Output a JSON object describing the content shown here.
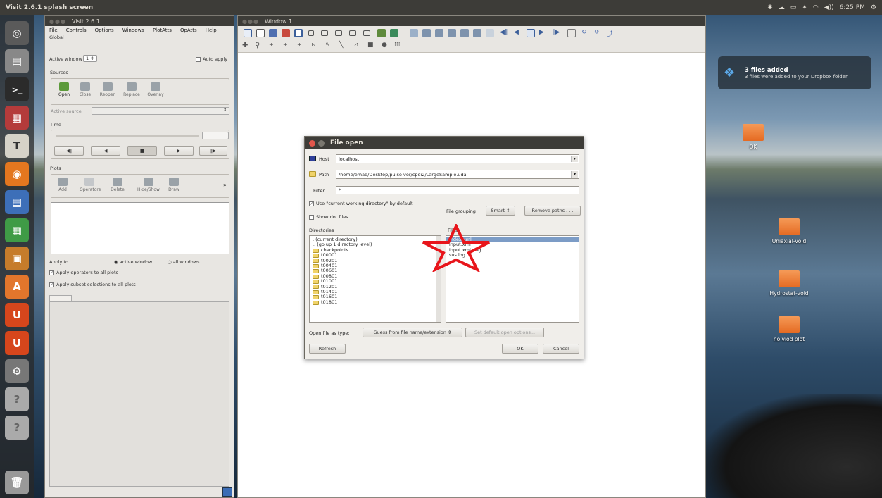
{
  "top_panel": {
    "title": "Visit 2.6.1 splash screen",
    "clock": "6:25 PM",
    "volume": "◀))"
  },
  "visit_window": {
    "title": "Visit 2.6.1",
    "menu": [
      "File",
      "Controls",
      "Options",
      "Windows",
      "PlotAtts",
      "OpAtts",
      "Help"
    ],
    "global_label": "Global",
    "active_window_label": "Active window",
    "active_window_value": "1",
    "auto_apply_label": "Auto apply",
    "sources_label": "Sources",
    "source_buttons": [
      "Open",
      "Close",
      "Reopen",
      "Replace",
      "Overlay"
    ],
    "active_source_label": "Active source",
    "time_label": "Time",
    "transport": [
      "◀‖",
      "◀",
      "■",
      "▶",
      "‖▶"
    ],
    "plots_label": "Plots",
    "plot_buttons": [
      "Add",
      "Operators",
      "Delete",
      "Hide/Show",
      "Draw"
    ],
    "plot_more": "»",
    "apply_to_label": "Apply to",
    "active_window_radio": "active window",
    "all_windows_radio": "all windows",
    "apply_operators": "Apply operators to all plots",
    "apply_subset": "Apply subset selections to all plots"
  },
  "window1": {
    "title": "Window 1"
  },
  "file_dialog": {
    "title": "File open",
    "host_label": "Host",
    "host_value": "localhost",
    "path_label": "Path",
    "path_value": "/home/emad/Desktop/pulse-ver/cpdi2/LargeSample.uda",
    "filter_label": "Filter",
    "filter_value": "*",
    "use_cwd": "Use \"current working directory\" by default",
    "show_dot": "Show dot files",
    "file_grouping_label": "File grouping",
    "file_grouping_value": "Smart",
    "remove_paths": "Remove paths . . .",
    "directories_label": "Directories",
    "files_label": "Files",
    "directories": [
      ". (current directory)",
      ".. (go up 1 directory level)",
      "checkpoints",
      "t00001",
      "t00201",
      "t00401",
      "t00601",
      "t00801",
      "t01001",
      "t01201",
      "t01401",
      "t01601",
      "t01801"
    ],
    "files": [
      "index.xml",
      "input.xml",
      "input.xml.orig",
      "sus.log"
    ],
    "open_as_label": "Open file as type:",
    "open_as_value": "Guess from file name/extension",
    "set_default": "Set default open options...",
    "refresh": "Refresh",
    "ok": "OK",
    "cancel": "Cancel"
  },
  "notification": {
    "title": "3 files added",
    "body": "3 files were added to your Dropbox folder."
  },
  "desktop_folders": [
    "OK",
    "Uniaxial-void",
    "Hydrostat-void",
    "no viod plot"
  ],
  "annotation_color": "#e8151b"
}
